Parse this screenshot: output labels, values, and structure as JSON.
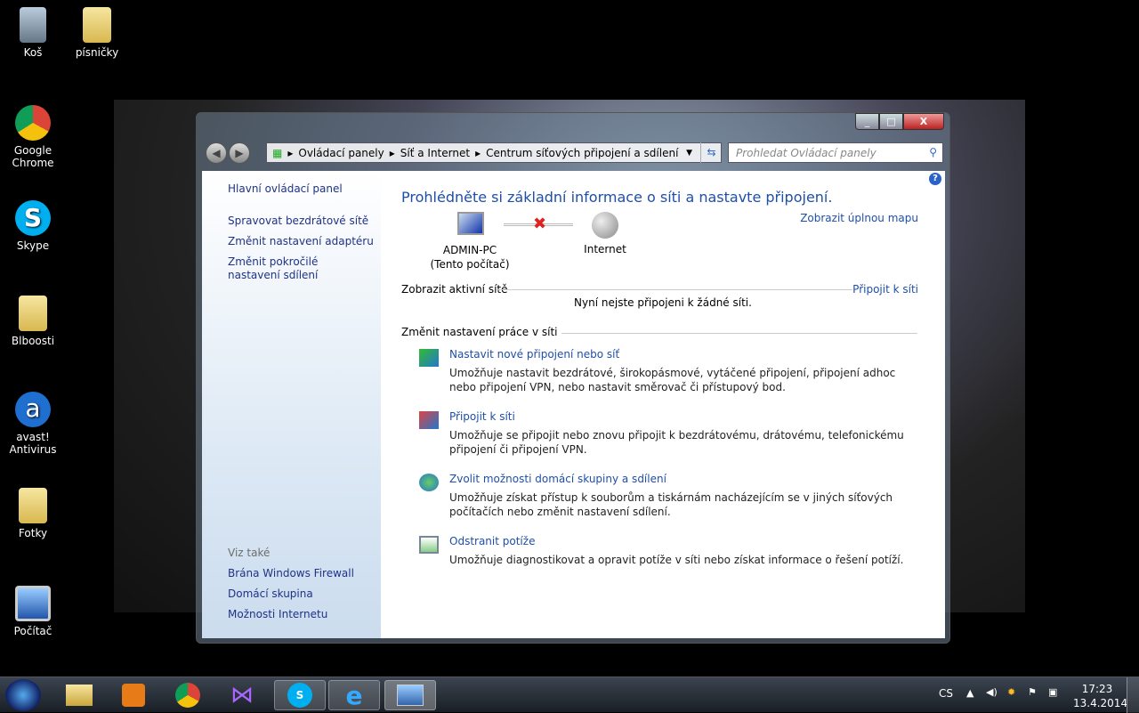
{
  "desktop": {
    "icons": [
      "Koš",
      "písničky",
      "Google Chrome",
      "Skype",
      "Blboosti",
      "avast! Antivirus",
      "Fotky",
      "Počítač"
    ]
  },
  "window": {
    "controls": {
      "minimize": "_",
      "maximize": "□",
      "close": "X"
    },
    "breadcrumb": [
      "Ovládací panely",
      "Síť a Internet",
      "Centrum síťových připojení a sdílení"
    ],
    "search_placeholder": "Prohledat Ovládací panely",
    "help": "?"
  },
  "sidebar": {
    "items": [
      "Hlavní ovládací panel",
      "Spravovat bezdrátové sítě",
      "Změnit nastavení adaptéru",
      "Změnit pokročilé nastavení sdílení"
    ],
    "see_also_label": "Viz také",
    "see_also": [
      "Brána Windows Firewall",
      "Domácí skupina",
      "Možnosti Internetu"
    ]
  },
  "main": {
    "title": "Prohlédněte si základní informace o síti a nastavte připojení.",
    "full_map": "Zobrazit úplnou mapu",
    "computer_name": "ADMIN-PC",
    "computer_sub": "(Tento počítač)",
    "internet": "Internet",
    "active_networks": "Zobrazit aktivní sítě",
    "connect": "Připojit k síti",
    "not_connected": "Nyní nejste připojeni k žádné síti.",
    "change_settings": "Změnit nastavení práce v síti",
    "tasks": [
      {
        "title": "Nastavit nové připojení nebo síť",
        "desc": "Umožňuje nastavit bezdrátové, širokopásmové, vytáčené připojení, připojení adhoc nebo připojení VPN, nebo nastavit směrovač či přístupový bod."
      },
      {
        "title": "Připojit k síti",
        "desc": "Umožňuje se připojit nebo znovu připojit k bezdrátovému, drátovému, telefonickému připojení či připojení VPN."
      },
      {
        "title": "Zvolit možnosti domácí skupiny a sdílení",
        "desc": "Umožňuje získat přístup k souborům a tiskárnám nacházejícím se v jiných síťových počítačích nebo změnit nastavení sdílení."
      },
      {
        "title": "Odstranit potíže",
        "desc": "Umožňuje diagnostikovat a opravit potíže v síti nebo získat informace o řešení potíží."
      }
    ]
  },
  "taskbar": {
    "language": "CS",
    "time": "17:23",
    "date": "13.4.2014"
  }
}
